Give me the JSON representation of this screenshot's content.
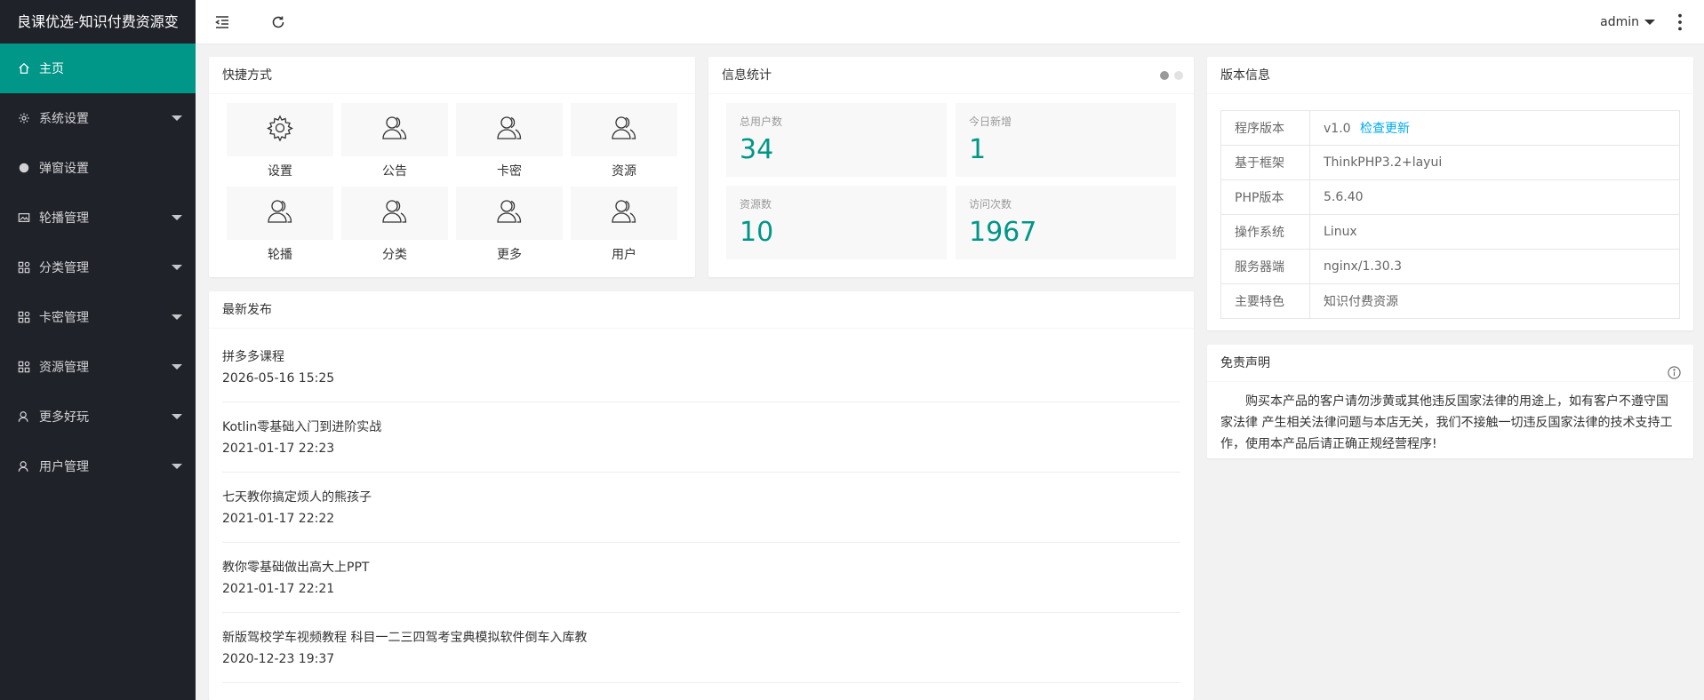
{
  "app": {
    "title": "良课优选-知识付费资源变"
  },
  "colors": {
    "accent": "#009688",
    "sidebar_bg": "#20222a",
    "link": "#01AAED"
  },
  "sidebar": {
    "items": [
      {
        "label": "主页",
        "icon": "home-icon",
        "active": true
      },
      {
        "label": "系统设置",
        "icon": "gear-icon"
      },
      {
        "label": "弹窗设置",
        "icon": "circle-icon"
      },
      {
        "label": "轮播管理",
        "icon": "image-icon"
      },
      {
        "label": "分类管理",
        "icon": "app-icon"
      },
      {
        "label": "卡密管理",
        "icon": "app-icon"
      },
      {
        "label": "资源管理",
        "icon": "app-icon"
      },
      {
        "label": "更多好玩",
        "icon": "user-icon"
      },
      {
        "label": "用户管理",
        "icon": "user-icon"
      }
    ]
  },
  "header": {
    "user": "admin"
  },
  "quick": {
    "title": "快捷方式",
    "items": [
      {
        "label": "设置",
        "icon": "gear-icon"
      },
      {
        "label": "公告",
        "icon": "users-icon"
      },
      {
        "label": "卡密",
        "icon": "users-icon"
      },
      {
        "label": "资源",
        "icon": "users-icon"
      },
      {
        "label": "轮播",
        "icon": "users-icon"
      },
      {
        "label": "分类",
        "icon": "users-icon"
      },
      {
        "label": "更多",
        "icon": "users-icon"
      },
      {
        "label": "用户",
        "icon": "users-icon"
      }
    ]
  },
  "stats": {
    "title": "信息统计",
    "items": [
      {
        "label": "总用户数",
        "value": "34"
      },
      {
        "label": "今日新增",
        "value": "1"
      },
      {
        "label": "资源数",
        "value": "10"
      },
      {
        "label": "访问次数",
        "value": "1967"
      }
    ]
  },
  "version": {
    "title": "版本信息",
    "rows": [
      {
        "key": "程序版本",
        "value": "v1.0",
        "link": "检查更新"
      },
      {
        "key": "基于框架",
        "value": "ThinkPHP3.2+layui"
      },
      {
        "key": "PHP版本",
        "value": "5.6.40"
      },
      {
        "key": "操作系统",
        "value": "Linux"
      },
      {
        "key": "服务器端",
        "value": "nginx/1.30.3"
      },
      {
        "key": "主要特色",
        "value": "知识付费资源"
      }
    ]
  },
  "news": {
    "title": "最新发布",
    "items": [
      {
        "title": "拼多多课程",
        "time": "2026-05-16 15:25"
      },
      {
        "title": "Kotlin零基础入门到进阶实战",
        "time": "2021-01-17 22:23"
      },
      {
        "title": "七天教你搞定烦人的熊孩子",
        "time": "2021-01-17 22:22"
      },
      {
        "title": "教你零基础做出高大上PPT",
        "time": "2021-01-17 22:21"
      },
      {
        "title": "新版驾校学车视频教程 科目一二三四驾考宝典模拟软件倒车入库教",
        "time": "2020-12-23 19:37"
      }
    ]
  },
  "disclaimer": {
    "title": "免责声明",
    "text": "购买本产品的客户请勿涉黄或其他违反国家法律的用途上，如有客户不遵守国家法律 产生相关法律问题与本店无关，我们不接触一切违反国家法律的技术支持工作，使用本产品后请正确正规经营程序!"
  }
}
